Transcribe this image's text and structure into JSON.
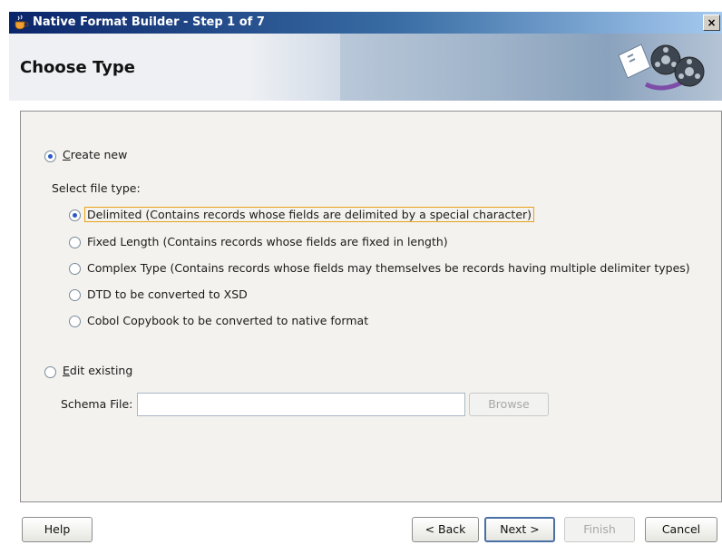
{
  "window": {
    "title": "Native Format Builder - Step 1 of 7",
    "close_label": "×"
  },
  "header": {
    "page_title": "Choose Type"
  },
  "options": {
    "create_new": {
      "mnemonic": "C",
      "rest": "reate new",
      "selected": true
    },
    "select_file_type_label": "Select file type:",
    "file_types": [
      {
        "label": "Delimited (Contains records whose fields are delimited by a special character)",
        "selected": true
      },
      {
        "label": "Fixed Length (Contains records whose fields are fixed in length)",
        "selected": false
      },
      {
        "label": "Complex Type (Contains records whose fields may themselves be records having multiple delimiter types)",
        "selected": false
      },
      {
        "label": "DTD to be converted to XSD",
        "selected": false
      },
      {
        "label": "Cobol Copybook to be converted to native format",
        "selected": false
      }
    ],
    "edit_existing": {
      "mnemonic": "E",
      "rest": "dit existing",
      "selected": false
    },
    "schema_file_label": "Schema File:",
    "schema_file_value": "",
    "browse_label": "Browse"
  },
  "footer": {
    "help_label": "Help",
    "back_label": "< Back",
    "next_label": "Next >",
    "finish_label": "Finish",
    "cancel_label": "Cancel"
  },
  "colors": {
    "accent": "#2d59c8",
    "focus_border": "#e8a317",
    "titlebar": "#0a246a"
  }
}
